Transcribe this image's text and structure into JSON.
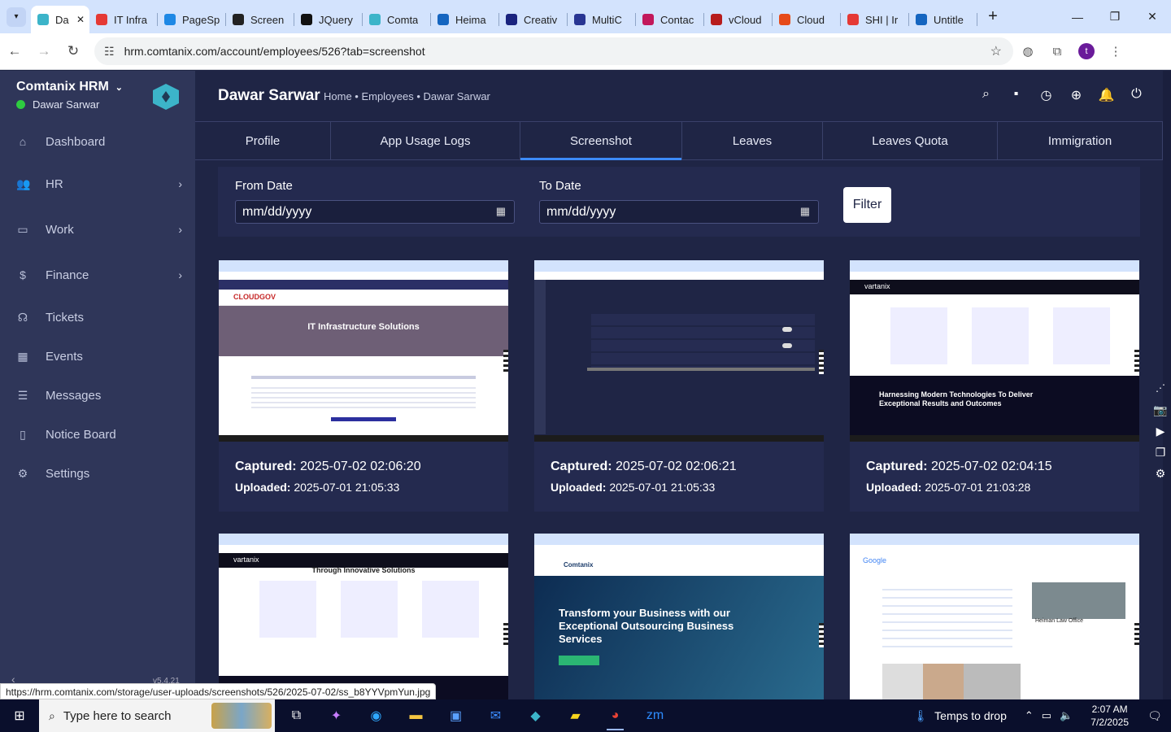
{
  "browser": {
    "tabs": [
      {
        "title": "Da",
        "color": "#3cb4c9",
        "active": true
      },
      {
        "title": "IT Infra",
        "color": "#e53935"
      },
      {
        "title": "PageSp",
        "color": "#1e88e5"
      },
      {
        "title": "Screen",
        "color": "#222222"
      },
      {
        "title": "JQuery",
        "color": "#111111"
      },
      {
        "title": "Comta",
        "color": "#3cb4c9"
      },
      {
        "title": "Heima",
        "color": "#1565c0"
      },
      {
        "title": "Creativ",
        "color": "#1a237e"
      },
      {
        "title": "MultiC",
        "color": "#283593"
      },
      {
        "title": "Contac",
        "color": "#c2185b"
      },
      {
        "title": "vCloud",
        "color": "#b71c1c"
      },
      {
        "title": "Cloud",
        "color": "#e64a19"
      },
      {
        "title": "SHI | Ir",
        "color": "#e53935"
      },
      {
        "title": "Untitle",
        "color": "#1565c0"
      }
    ],
    "url": "hrm.comtanix.com/account/employees/526?tab=screenshot",
    "profile_initial": "t",
    "status_link": "https://hrm.comtanix.com/storage/user-uploads/screenshots/526/2025-07-02/ss_b8YYVpmYun.jpg"
  },
  "sidebar": {
    "brand": "Comtanix HRM",
    "user": "Dawar Sarwar",
    "items": [
      {
        "label": "Dashboard",
        "icon": "home-icon",
        "glyph": "⌂"
      },
      {
        "label": "HR",
        "icon": "users-icon",
        "glyph": "👥",
        "chevron": "›"
      },
      {
        "label": "Work",
        "icon": "briefcase-icon",
        "glyph": "▭",
        "chevron": "›"
      },
      {
        "label": "Finance",
        "icon": "dollar-icon",
        "glyph": "$",
        "chevron": "›"
      },
      {
        "label": "Tickets",
        "icon": "headset-icon",
        "glyph": "☊"
      },
      {
        "label": "Events",
        "icon": "calendar-icon",
        "glyph": "▦"
      },
      {
        "label": "Messages",
        "icon": "chat-icon",
        "glyph": "☰"
      },
      {
        "label": "Notice Board",
        "icon": "clipboard-icon",
        "glyph": "▯"
      },
      {
        "label": "Settings",
        "icon": "gear-icon",
        "glyph": "⚙"
      }
    ],
    "version": "v5.4.21"
  },
  "header": {
    "title": "Dawar Sarwar",
    "breadcrumb": "Home • Employees • Dawar Sarwar"
  },
  "tabs": [
    {
      "label": "Profile"
    },
    {
      "label": "App Usage Logs"
    },
    {
      "label": "Screenshot",
      "active": true
    },
    {
      "label": "Leaves"
    },
    {
      "label": "Leaves Quota"
    },
    {
      "label": "Immigration"
    }
  ],
  "filter": {
    "from_label": "From Date",
    "from_placeholder": "mm/dd/yyyy",
    "to_label": "To Date",
    "to_placeholder": "mm/dd/yyyy",
    "button": "Filter"
  },
  "screenshots": [
    {
      "captured_label": "Captured:",
      "captured": "2025-07-02 02:06:20",
      "uploaded_label": "Uploaded:",
      "uploaded": "2025-07-01 21:05:33",
      "headline": "IT Infrastructure Solutions",
      "theme": "cloudgov"
    },
    {
      "captured_label": "Captured:",
      "captured": "2025-07-02 02:06:21",
      "uploaded_label": "Uploaded:",
      "uploaded": "2025-07-01 21:05:33",
      "headline": "",
      "theme": "hrm"
    },
    {
      "captured_label": "Captured:",
      "captured": "2025-07-02 02:04:15",
      "uploaded_label": "Uploaded:",
      "uploaded": "2025-07-01 21:03:28",
      "headline": "Harnessing Modern Technologies To Deliver Exceptional Results and Outcomes",
      "theme": "vartanix"
    },
    {
      "captured_label": "",
      "captured": "",
      "uploaded_label": "",
      "uploaded": "",
      "headline": "Through Innovative Solutions",
      "theme": "vartanix2"
    },
    {
      "captured_label": "",
      "captured": "",
      "uploaded_label": "",
      "uploaded": "",
      "headline": "Transform your Business with our Exceptional Outsourcing Business Services",
      "theme": "comtanix"
    },
    {
      "captured_label": "",
      "captured": "",
      "uploaded_label": "",
      "uploaded": "",
      "headline": "Heiman Law Office",
      "theme": "google"
    }
  ],
  "taskbar": {
    "search_placeholder": "Type here to search",
    "weather": "Temps to drop",
    "time": "2:07 AM",
    "date": "7/2/2025"
  }
}
